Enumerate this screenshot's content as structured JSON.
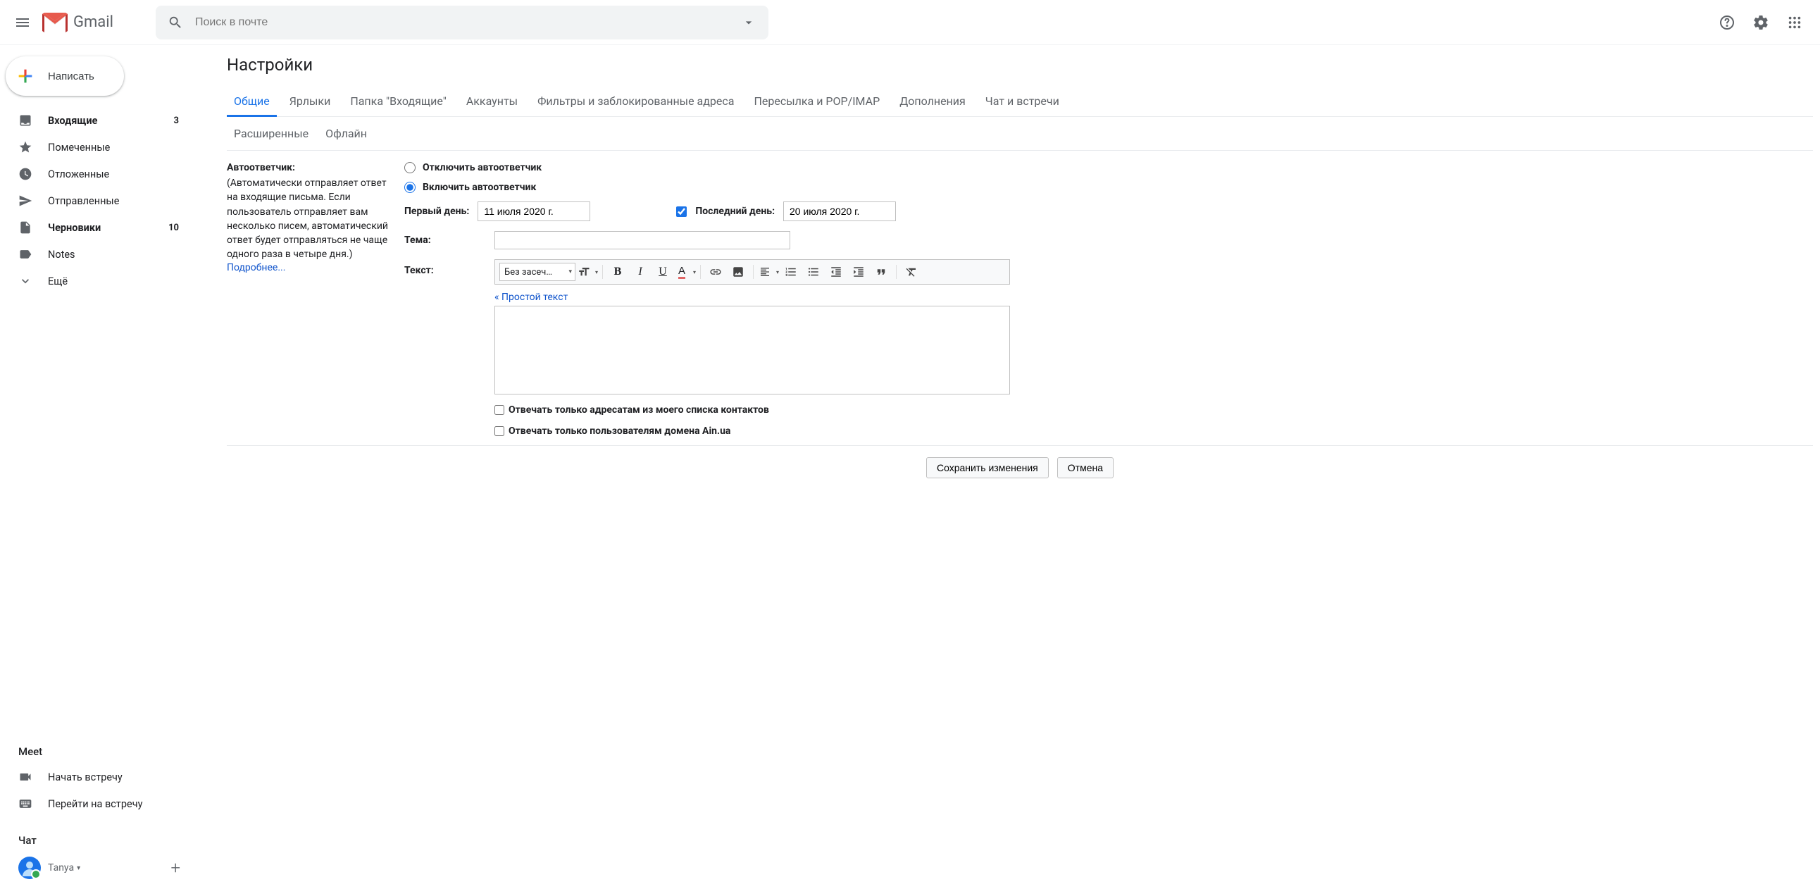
{
  "header": {
    "app_name": "Gmail",
    "search_placeholder": "Поиск в почте"
  },
  "sidebar": {
    "compose": "Написать",
    "items": [
      {
        "label": "Входящие",
        "count": "3",
        "bold": true
      },
      {
        "label": "Помеченные",
        "count": "",
        "bold": false
      },
      {
        "label": "Отложенные",
        "count": "",
        "bold": false
      },
      {
        "label": "Отправленные",
        "count": "",
        "bold": false
      },
      {
        "label": "Черновики",
        "count": "10",
        "bold": true
      },
      {
        "label": "Notes",
        "count": "",
        "bold": false
      },
      {
        "label": "Ещё",
        "count": "",
        "bold": false
      }
    ],
    "meet_title": "Meet",
    "meet_start": "Начать встречу",
    "meet_join": "Перейти на встречу",
    "chat_title": "Чат",
    "chat_user": "Tanya"
  },
  "main": {
    "title": "Настройки",
    "tabs": [
      "Общие",
      "Ярлыки",
      "Папка \"Входящие\"",
      "Аккаунты",
      "Фильтры и заблокированные адреса",
      "Пересылка и POP/IMAP",
      "Дополнения",
      "Чат и встречи"
    ],
    "tabs2": [
      "Расширенные",
      "Офлайн"
    ],
    "setting": {
      "title": "Автоответчик:",
      "desc": "(Автоматически отправляет ответ на входящие письма. Если пользователь отправляет вам несколько писем, автоматический ответ будет отправляться не чаще одного раза в четыре дня.)",
      "more": "Подробнее..."
    },
    "radio_off": "Отключить автоответчик",
    "radio_on": "Включить автоответчик",
    "first_day_label": "Первый день:",
    "first_day_value": "11 июля 2020 г.",
    "last_day_label": "Последний день:",
    "last_day_value": "20 июля 2020 г.",
    "subject_label": "Тема:",
    "text_label": "Текст:",
    "font_label": "Без засеч…",
    "plain_text": "« Простой текст",
    "contacts_only": "Отвечать только адресатам из моего списка контактов",
    "domain_only": "Отвечать только пользователям домена Ain.ua",
    "save": "Сохранить изменения",
    "cancel": "Отмена"
  }
}
